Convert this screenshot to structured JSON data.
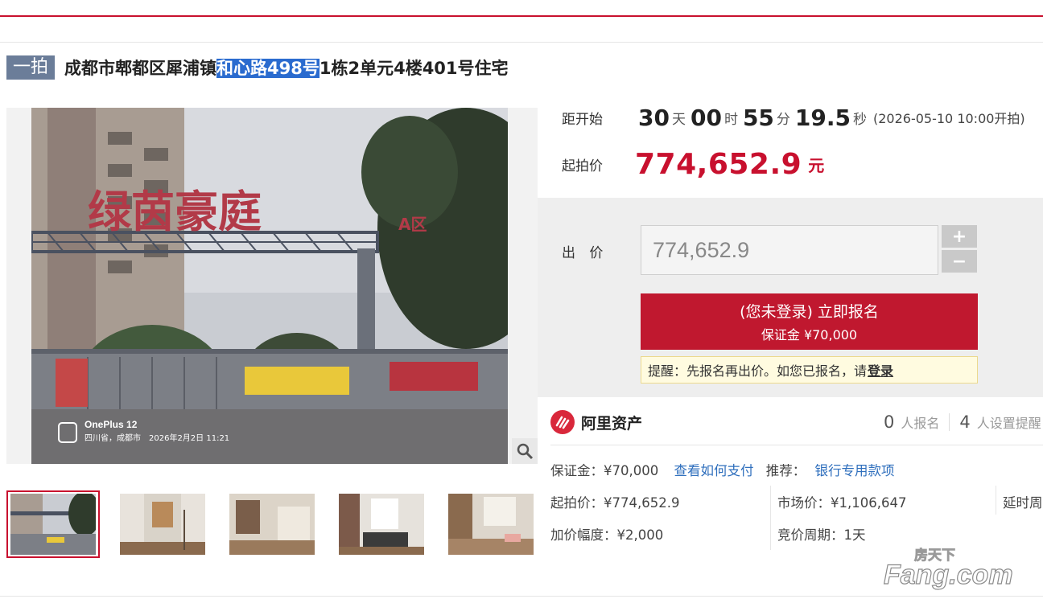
{
  "title": {
    "tag": "一拍",
    "prefix": "成都市郫都区犀浦镇",
    "highlight": "和心路498号",
    "suffix": "1栋2单元4楼401号住宅"
  },
  "countdown": {
    "label": "距开始",
    "days": "30",
    "days_unit": "天",
    "hours": "00",
    "hours_unit": "时",
    "minutes": "55",
    "minutes_unit": "分",
    "seconds": "19.5",
    "seconds_unit": "秒",
    "start_text": "(2026-05-10 10:00开拍)"
  },
  "start_price": {
    "label": "起拍价",
    "value": "774,652.9",
    "unit": "元"
  },
  "bid": {
    "label": "出 价",
    "input_value": "774,652.9",
    "plus": "+",
    "minus": "−",
    "register_line1": "(您未登录) 立即报名",
    "register_line2": "保证金 ¥70,000",
    "reminder_text": "提醒：先报名再出价。如您已报名，请",
    "reminder_login": "登录"
  },
  "brand": {
    "name": "阿里资产",
    "registrants": "0",
    "registrants_label": "人报名",
    "reminders": "4",
    "reminders_label": "人设置提醒"
  },
  "info": {
    "deposit": "保证金：¥70,000",
    "pay_link": "查看如何支付",
    "recommend_label": "推荐：",
    "recommend_link": "银行专用款项",
    "start_price": "起拍价：¥774,652.9",
    "market_price": "市场价：¥1,106,647",
    "delay": "延时周",
    "increment": "加价幅度：¥2,000",
    "period": "竞价周期：1天"
  },
  "photo": {
    "sign_text": "绿茵豪庭",
    "zone_text": "A区",
    "camera": "OnePlus 12",
    "location": "四川省，成都市",
    "date": "2026年2月2日 11:21"
  },
  "watermark": {
    "line1": "房天下",
    "line2": "Fang.com"
  },
  "colors": {
    "accent": "#c8102e",
    "link": "#2f6fbd",
    "tag_bg": "#6b7d99"
  }
}
